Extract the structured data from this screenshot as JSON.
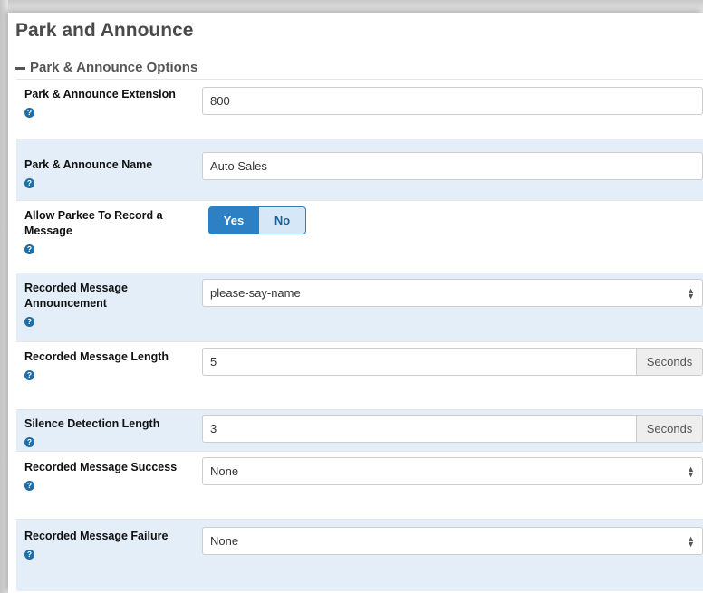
{
  "page": {
    "title": "Park and Announce",
    "section_title": "Park & Announce Options"
  },
  "help_glyph": "?",
  "fields": [
    {
      "label": "Park & Announce Extension",
      "type": "text",
      "value": "800"
    },
    {
      "label": "Park & Announce Name",
      "type": "text",
      "value": "Auto Sales"
    },
    {
      "label": "Allow Parkee To Record a Message",
      "type": "toggle",
      "options": [
        "Yes",
        "No"
      ],
      "selected": "Yes"
    },
    {
      "label": "Recorded Message Announcement",
      "type": "select",
      "value": "please-say-name"
    },
    {
      "label": "Recorded Message Length",
      "type": "text-addon",
      "value": "5",
      "addon": "Seconds"
    },
    {
      "label": "Silence Detection Length",
      "type": "text-addon",
      "value": "3",
      "addon": "Seconds"
    },
    {
      "label": "Recorded Message Success",
      "type": "select",
      "value": "None"
    },
    {
      "label": "Recorded Message Failure",
      "type": "select",
      "value": "None"
    }
  ],
  "colors": {
    "accent": "#2d80c4",
    "alt_row": "#e3eef8",
    "help_icon": "#1e6fa9"
  }
}
